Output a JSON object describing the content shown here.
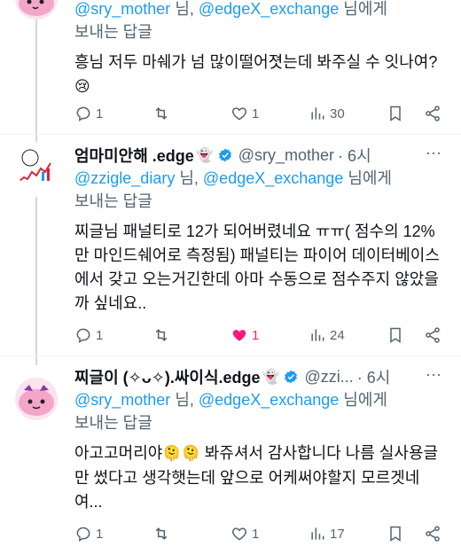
{
  "posts": [
    {
      "author": "",
      "handle": "",
      "time": "",
      "reply_prefix": "",
      "reply_users": [
        "@sry_mother",
        "@edgeX_exchange"
      ],
      "reply_sep": " 님, ",
      "reply_suffix_1": " 님에게",
      "reply_suffix_2": "보내는 답글",
      "text": "흥님 저두 마쉐가 넘 많이떨어졋는데 봐주실 수 잇나여?",
      "text_emoji": "😢",
      "replies": "1",
      "reposts": "",
      "likes": "1",
      "views": "30"
    },
    {
      "author": "엄마미안해 .edge",
      "handle": "@sry_mother",
      "time": "· 6시",
      "reply_users": [
        "@zzigle_diary",
        "@edgeX_exchange"
      ],
      "reply_sep": " 님, ",
      "reply_suffix_1": " 님에게",
      "reply_suffix_2": "보내는 답글",
      "text": "찌글님 패널티로 12가 되어버렸네요 ㅠㅠ( 점수의 12%만 마인드쉐어로 측정됨) 패널티는 파이어 데이터베이스에서 갖고 오는거긴한데 아마 수동으로 점수주지 않았을까 싶네요..",
      "replies": "1",
      "reposts": "",
      "likes": "1",
      "views": "24"
    },
    {
      "author": "찌글이 (✧ᴗ✧).싸이식.edge",
      "handle": "@zzi...",
      "time": "· 6시",
      "reply_users": [
        "@sry_mother",
        "@edgeX_exchange"
      ],
      "reply_sep": " 님, ",
      "reply_suffix_1": " 님에게",
      "reply_suffix_2": "보내는 답글",
      "text": "아고고머리야",
      "text_emoji": "🫠🫠",
      "text_rest": " 봐쥬셔서 감사합니다 나름 실사용글만 썼다고 생각햇는데 앞으로 어케써야할지 모르겟네여...",
      "replies": "1",
      "reposts": "",
      "likes": "1",
      "views": "17"
    }
  ],
  "ghost_emoji": "👻",
  "more_icon": "···",
  "colors": {
    "link": "#1d9bf0",
    "muted": "#536471",
    "like_active": "#f91880",
    "verified": "#1d9bf0"
  }
}
